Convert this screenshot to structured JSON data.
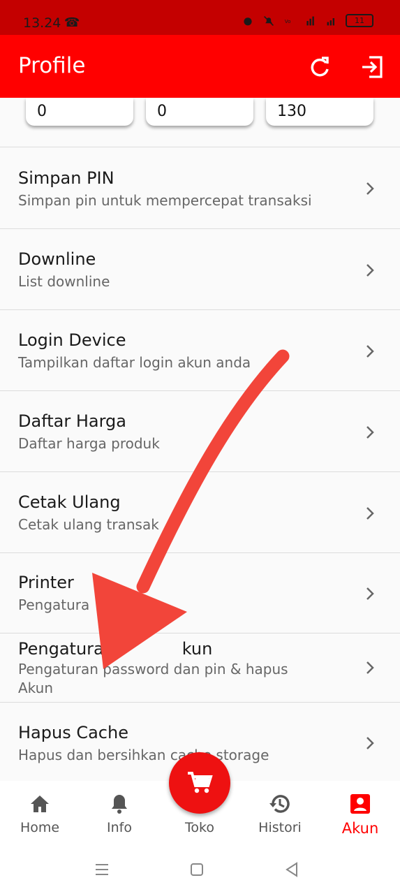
{
  "status_bar": {
    "time": "13.24",
    "battery": "11"
  },
  "app_bar": {
    "title": "Profile",
    "refresh_icon": "refresh-icon",
    "logout_icon": "logout-icon"
  },
  "stats": [
    "0",
    "0",
    "130"
  ],
  "menu": [
    {
      "title": "Simpan PIN",
      "subtitle": "Simpan pin untuk mempercepat transaksi"
    },
    {
      "title": "Downline",
      "subtitle": "List downline"
    },
    {
      "title": "Login Device",
      "subtitle": "Tampilkan daftar login akun anda"
    },
    {
      "title": "Daftar Harga",
      "subtitle": "Daftar harga produk"
    },
    {
      "title": "Cetak Ulang",
      "subtitle": "Cetak ulang transak"
    },
    {
      "title": "Printer",
      "subtitle": "Pengatura"
    },
    {
      "title": "Pengatura",
      "subtitle": "Pengaturan password dan pin & hapus Akun",
      "title_tail": "kun"
    },
    {
      "title": "Hapus Cache",
      "subtitle": "Hapus dan bersihkan cache storage"
    }
  ],
  "bottom_nav": [
    {
      "label": "Home",
      "icon": "home-icon"
    },
    {
      "label": "Info",
      "icon": "bell-icon"
    },
    {
      "label": "Toko",
      "icon": "cart-icon"
    },
    {
      "label": "Histori",
      "icon": "history-icon"
    },
    {
      "label": "Akun",
      "icon": "account-icon",
      "active": true
    }
  ],
  "colors": {
    "primary": "#ff0000",
    "status_bar": "#c40000",
    "annotation_arrow": "#f2453a"
  }
}
